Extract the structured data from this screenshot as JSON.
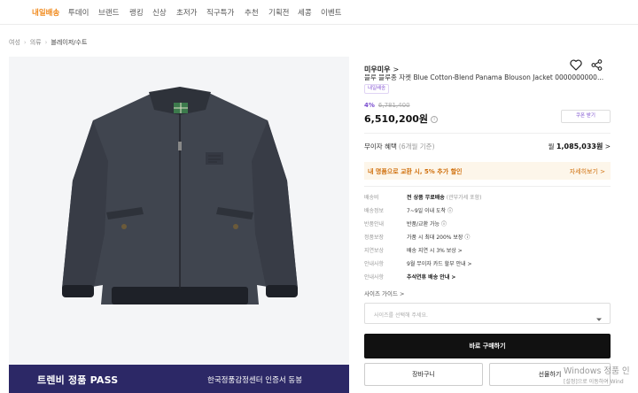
{
  "nav": {
    "items": [
      "내일배송",
      "투데이",
      "브랜드",
      "랭킹",
      "신상",
      "초저가",
      "직구특가",
      "추천",
      "기획전",
      "세콩",
      "이벤트"
    ]
  },
  "breadcrumb": [
    "여성",
    "의류",
    "블레이저/수트"
  ],
  "banner": {
    "title": "트렌비 정품 PASS",
    "subtitle": "한국정품감정센터 인증서 동봉"
  },
  "product": {
    "brand": "미우미우",
    "brand_chevron": ">",
    "title": "블루 블루종 자켓 Blue Cotton-Blend Panama Blouson Jacket 0000000000...",
    "badge": "내일배송",
    "discount": "4%",
    "original_price": "6,781,400",
    "price": "6,510,200원",
    "price_info_icon": "i",
    "coupon_label": "쿠폰 받기"
  },
  "installment": {
    "label": "무이자 혜택",
    "sub": "(6개월 기준)",
    "prefix": "월",
    "amount": "1,085,033원",
    "chevron": ">"
  },
  "promo": {
    "text": "내 명품으로 교환 시, 5% 추가 할인",
    "link": "자세히보기 >"
  },
  "specs": [
    {
      "key": "배송비",
      "value_bold": "전 상품 무료배송",
      "value_muted": "(관부가세 포함)"
    },
    {
      "key": "배송정보",
      "value_bold": "",
      "value": "7~9일 이내 도착 ⓘ"
    },
    {
      "key": "반품안내",
      "value_bold": "",
      "value": "반품/교환 가능 ⓘ"
    },
    {
      "key": "정품보장",
      "value_bold": "",
      "value": "가품 시 최대 200% 보장 ⓘ"
    },
    {
      "key": "지연보상",
      "value_bold": "",
      "value": "배송 지연 시 3% 보상 >"
    },
    {
      "key": "안내사항",
      "value_bold": "",
      "value": "9월 무이자 카드 할부 안내 >"
    },
    {
      "key": "안내사항",
      "value_bold": "추석연휴 배송 안내 >",
      "value_muted": ""
    }
  ],
  "size": {
    "guide": "사이즈 가이드 >",
    "placeholder": "사이즈를 선택해 주세요."
  },
  "actions": {
    "buy": "바로 구매하기",
    "cart": "장바구니",
    "gift": "선물하기"
  },
  "watermark": {
    "line1": "Windows 정품 인",
    "line2": "[설정]으로 이동하여 Wind"
  },
  "colors": {
    "nav_active": "#f08a1d",
    "discount": "#7a4dcf",
    "promo_text": "#d0700d",
    "promo_bg": "#fdf6ea",
    "banner_bg": "#2c2866",
    "buy_bg": "#111111"
  },
  "icons": {
    "heart": "heart-icon",
    "share": "share-icon",
    "caret": "chevron-down-icon"
  }
}
